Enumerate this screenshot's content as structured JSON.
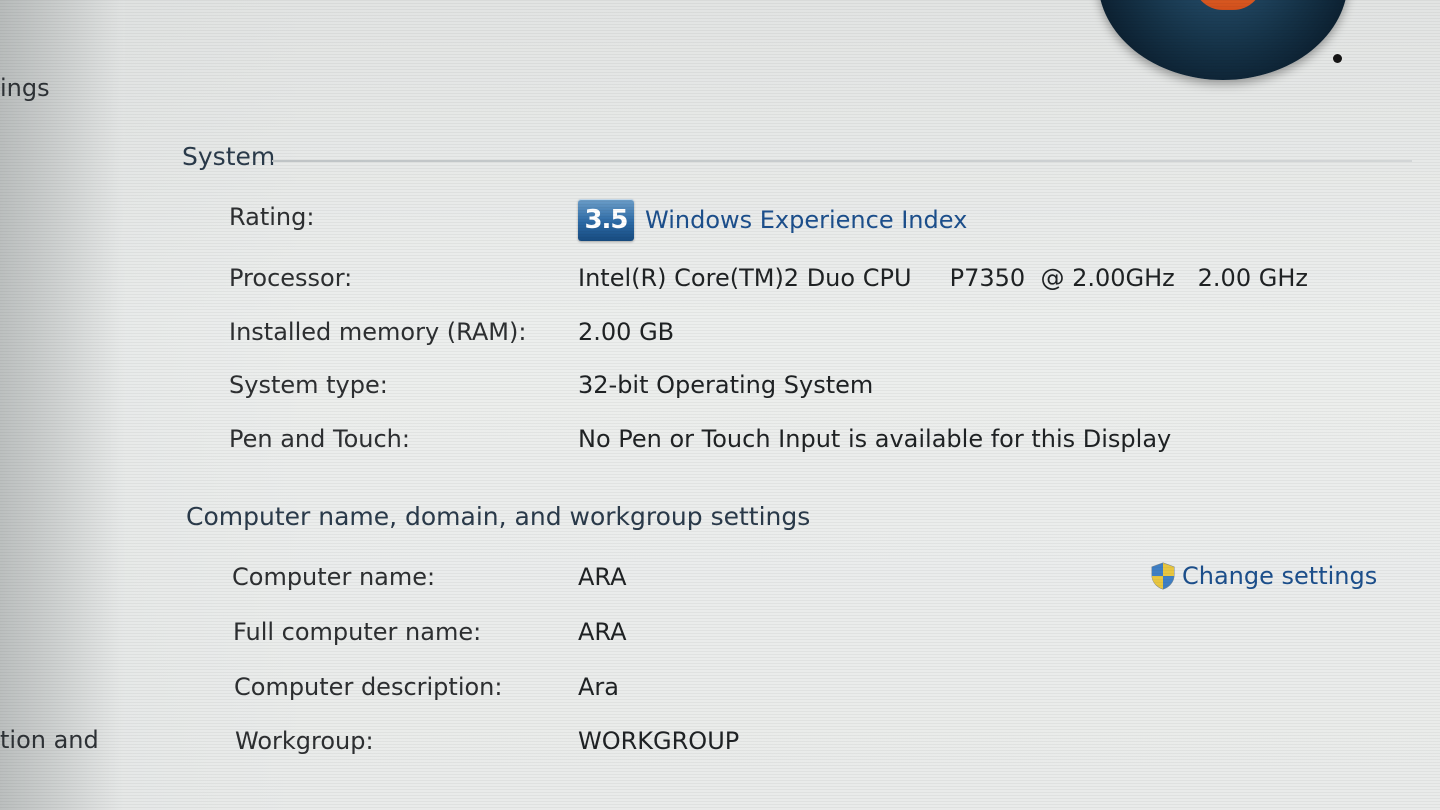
{
  "left_nav": {
    "partial_link_1": "ings",
    "partial_link_2": "tion and"
  },
  "system": {
    "header": "System",
    "rating": {
      "label": "Rating:",
      "score": "3.5",
      "link": "Windows Experience Index"
    },
    "processor": {
      "label": "Processor:",
      "value": "Intel(R) Core(TM)2 Duo CPU     P7350  @ 2.00GHz   2.00 GHz"
    },
    "memory": {
      "label": "Installed memory (RAM):",
      "value": "2.00 GB"
    },
    "system_type": {
      "label": "System type:",
      "value": "32-bit Operating System"
    },
    "pen_touch": {
      "label": "Pen and Touch:",
      "value": "No Pen or Touch Input is available for this Display"
    }
  },
  "computer_name": {
    "header": "Computer name, domain, and workgroup settings",
    "change_settings": "Change settings",
    "name": {
      "label": "Computer name:",
      "value": "ARA"
    },
    "full_name": {
      "label": "Full computer name:",
      "value": "ARA"
    },
    "description": {
      "label": "Computer description:",
      "value": "Ara"
    },
    "workgroup": {
      "label": "Workgroup:",
      "value": "WORKGROUP"
    }
  },
  "colors": {
    "link": "#1c4f8c",
    "badge": "#2c6aa6",
    "text": "#2d2f31",
    "header": "#2a3a4a"
  },
  "icons": {
    "logo": "windows-logo-icon",
    "shield": "uac-shield-icon"
  }
}
